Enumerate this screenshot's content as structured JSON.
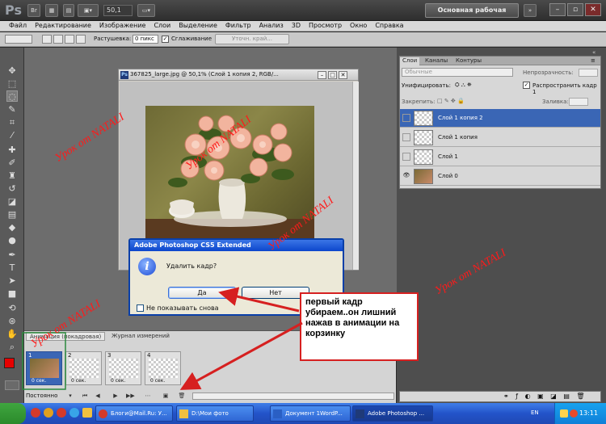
{
  "titlebar": {
    "app_logo": "Ps",
    "br_label": "Br",
    "zoom": "50,1",
    "workspace": "Основная рабочая среда",
    "colors": {
      "bg": "#3a3a3a",
      "workspace_btn": "#5a5a5a"
    }
  },
  "menu": {
    "items": [
      "Файл",
      "Редактирование",
      "Изображение",
      "Слои",
      "Выделение",
      "Фильтр",
      "Анализ",
      "3D",
      "Просмотр",
      "Окно",
      "Справка"
    ]
  },
  "options": {
    "feather_label": "Растушевка:",
    "feather_value": "0 пикс",
    "antialias_label": "Сглаживание",
    "refine_edge": "Уточн. край..."
  },
  "document": {
    "title": "367825_large.jpg @ 50,1% (Слой 1 копия 2, RGB/..."
  },
  "layers": {
    "tabs": [
      "Слои",
      "Каналы",
      "Контуры"
    ],
    "blend_mode": "Обычные",
    "opacity_label": "Непрозрачность:",
    "unify_label": "Унифицировать:",
    "propagate_label": "Распространить кадр 1",
    "lock_label": "Закрепить:",
    "fill_label": "Заливка:",
    "items": [
      {
        "name": "Слой 1 копия 2",
        "selected": true,
        "visible": false
      },
      {
        "name": "Слой 1 копия",
        "selected": false,
        "visible": false
      },
      {
        "name": "Слой 1",
        "selected": false,
        "visible": false
      },
      {
        "name": "Слой 0",
        "selected": false,
        "visible": true
      }
    ],
    "colors": {
      "selected": "#3a66b5"
    }
  },
  "animation": {
    "tabs": [
      "Анимация (покадровая)",
      "Журнал измерений"
    ],
    "frames": [
      {
        "number": "1",
        "delay": "0 сек.",
        "selected": true
      },
      {
        "number": "2",
        "delay": "0 сек.",
        "selected": false
      },
      {
        "number": "3",
        "delay": "0 сек.",
        "selected": false
      },
      {
        "number": "4",
        "delay": "0 сек.",
        "selected": false
      }
    ],
    "loop": "Постоянно"
  },
  "dialog": {
    "title": "Adobe Photoshop CS5 Extended",
    "message": "Удалить кадр?",
    "yes": "Да",
    "no": "Нет",
    "dont_show": "Не показывать снова"
  },
  "callout": {
    "text": "первый кадр убираем..он лишний нажав в анимации на корзинку",
    "color": "#d62020"
  },
  "watermark": {
    "text": "Урок от NATALI",
    "color": "#ff1a1a"
  },
  "taskbar": {
    "items": [
      "Блоги@Mail.Ru: У...",
      "D:\\Мои фото",
      "Документ 1WordP...",
      "Adobe Photoshop ..."
    ],
    "lang": "EN",
    "clock": "13:11"
  }
}
